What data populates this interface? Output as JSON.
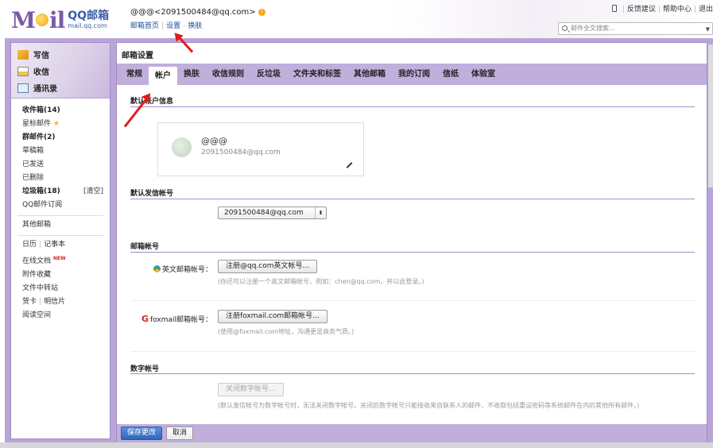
{
  "header": {
    "logo_letters_a": "M",
    "logo_letters_b": "il",
    "logo_brand": "QQ邮箱",
    "logo_url": "mail.qq.com",
    "account": "@@@<2091500484@qq.com>",
    "links": [
      "邮箱首页",
      "设置",
      "换肤"
    ],
    "top_links": [
      "反馈建议",
      "帮助中心",
      "退出"
    ],
    "search_placeholder": "邮件全文搜索..."
  },
  "sidebar": {
    "buttons": [
      "写信",
      "收信",
      "通讯录"
    ],
    "folders": {
      "inbox": "收件箱(14)",
      "starred": "星标邮件",
      "groups": "群邮件(2)",
      "drafts": "草稿箱",
      "sent": "已发送",
      "deleted": "已删除",
      "spam": "垃圾箱(18)",
      "clear": "[清空]",
      "subscriptions": "QQ邮件订阅",
      "other": "其他邮箱",
      "calendar": "日历",
      "notes": "记事本",
      "docs": "在线文档",
      "docs_badge": "NEW",
      "attachments": "附件收藏",
      "transfer": "文件中转站",
      "cards": "贺卡",
      "postcards": "明信片",
      "reading": "阅读空间"
    }
  },
  "main": {
    "title": "邮箱设置",
    "tabs": [
      "常规",
      "帐户",
      "换肤",
      "收信规则",
      "反垃圾",
      "文件夹和标签",
      "其他邮箱",
      "我的订阅",
      "信纸",
      "体验室"
    ],
    "active_tab": "帐户",
    "default_account": {
      "heading": "默认帐户信息",
      "name": "@@@",
      "email": "2091500484@qq.com"
    },
    "sender": {
      "heading": "默认发信帐号",
      "value": "2091500484@qq.com"
    },
    "accounts": {
      "heading": "邮箱帐号",
      "english_label": "英文邮箱帐号：",
      "english_button": "注册@qq.com英文帐号...",
      "english_hint": "(你还可以注册一个英文邮箱帐号，例如：chen@qq.com，并以此登录。)",
      "foxmail_label": "foxmail邮箱帐号：",
      "foxmail_button": "注册foxmail.com邮箱帐号...",
      "foxmail_hint": "(使用@foxmail.com地址，沟通更显商务气质。)"
    },
    "digital": {
      "heading": "数字帐号",
      "button": "关闭数字帐号...",
      "hint": "(默认发信帐号为数字帐号时，无法关闭数字帐号。关闭后数字帐号只能接收来自联系人的邮件，不收取包括重设密码等系统邮件在内的其他所有邮件。)"
    },
    "footer": {
      "save": "保存更改",
      "cancel": "取消"
    }
  },
  "colors": {
    "frame": "#b9a6d6",
    "tabs_bar": "#c0aedb",
    "arrow": "#e11b1b",
    "primary_button": "#2d66bc"
  }
}
